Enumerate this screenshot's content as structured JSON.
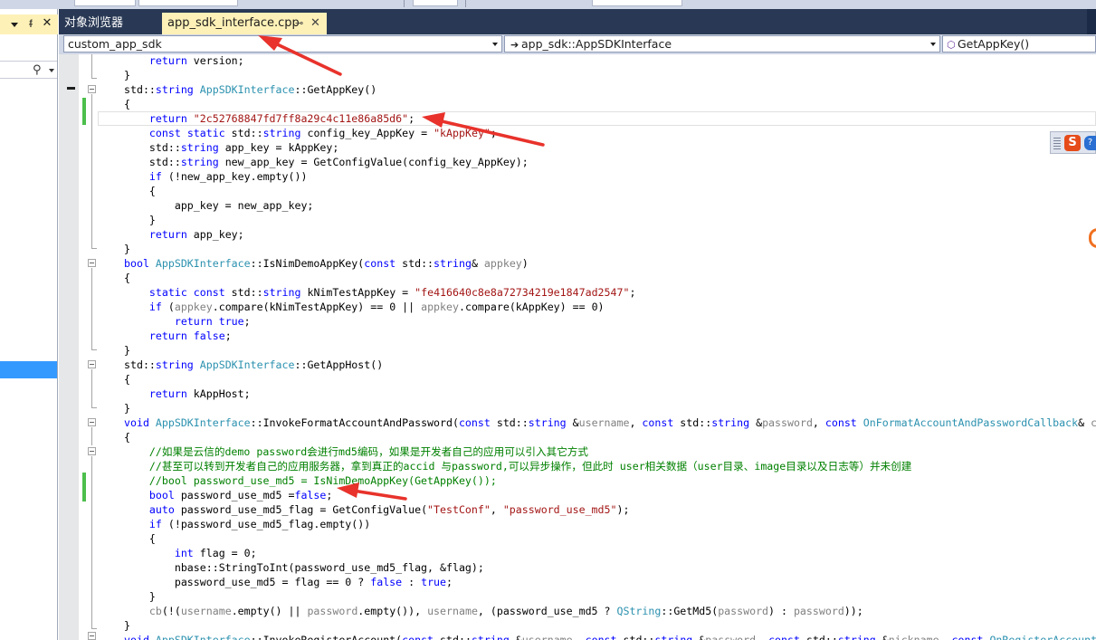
{
  "left_panel": {
    "search_icon": "search-icon"
  },
  "tabs": {
    "object_browser": "对象浏览器",
    "active_file": "app_sdk_interface.cpp",
    "pin_glyph": "⊸",
    "close_glyph": "✕"
  },
  "navigation": {
    "project": "custom_app_sdk",
    "class": "app_sdk::AppSDKInterface",
    "member": "GetAppKey()"
  },
  "code": {
    "lines": [
      [
        [
          "",
          "    "
        ],
        [
          "k",
          "return"
        ],
        [
          "",
          " version;"
        ]
      ],
      [
        [
          "",
          "}"
        ]
      ],
      [
        [
          "",
          "std::"
        ],
        [
          "k",
          "string"
        ],
        [
          "",
          " "
        ],
        [
          "t",
          "AppSDKInterface"
        ],
        [
          "",
          "::GetAppKey()"
        ]
      ],
      [
        [
          "",
          "{"
        ]
      ],
      [
        [
          "",
          "    "
        ],
        [
          "k",
          "return"
        ],
        [
          "",
          " "
        ],
        [
          "s",
          "\"2c52768847fd7ff8a29c4c11e86a85d6\""
        ],
        [
          "",
          ";"
        ]
      ],
      [
        [
          "",
          "    "
        ],
        [
          "k",
          "const"
        ],
        [
          "",
          " "
        ],
        [
          "k",
          "static"
        ],
        [
          "",
          " std::"
        ],
        [
          "k",
          "string"
        ],
        [
          "",
          " config_key_AppKey = "
        ],
        [
          "s",
          "\"kAppKey\""
        ],
        [
          "",
          ";"
        ]
      ],
      [
        [
          "",
          "    std::"
        ],
        [
          "k",
          "string"
        ],
        [
          "",
          " app_key = kAppKey;"
        ]
      ],
      [
        [
          "",
          "    std::"
        ],
        [
          "k",
          "string"
        ],
        [
          "",
          " new_app_key = GetConfigValue(config_key_AppKey);"
        ]
      ],
      [
        [
          "",
          "    "
        ],
        [
          "k",
          "if"
        ],
        [
          "",
          " (!new_app_key.empty())"
        ]
      ],
      [
        [
          "",
          "    {"
        ]
      ],
      [
        [
          "",
          "        app_key = new_app_key;"
        ]
      ],
      [
        [
          "",
          "    }"
        ]
      ],
      [
        [
          "",
          "    "
        ],
        [
          "k",
          "return"
        ],
        [
          "",
          " app_key;"
        ]
      ],
      [
        [
          "",
          "}"
        ]
      ],
      [
        [
          "k",
          "bool"
        ],
        [
          "",
          " "
        ],
        [
          "t",
          "AppSDKInterface"
        ],
        [
          "",
          "::IsNimDemoAppKey("
        ],
        [
          "k",
          "const"
        ],
        [
          "",
          " std::"
        ],
        [
          "k",
          "string"
        ],
        [
          "",
          "& "
        ],
        [
          "g",
          "appkey"
        ],
        [
          "",
          ")"
        ]
      ],
      [
        [
          "",
          "{"
        ]
      ],
      [
        [
          "",
          "    "
        ],
        [
          "k",
          "static"
        ],
        [
          "",
          " "
        ],
        [
          "k",
          "const"
        ],
        [
          "",
          " std::"
        ],
        [
          "k",
          "string"
        ],
        [
          "",
          " kNimTestAppKey = "
        ],
        [
          "s",
          "\"fe416640c8e8a72734219e1847ad2547\""
        ],
        [
          "",
          ";"
        ]
      ],
      [
        [
          "",
          "    "
        ],
        [
          "k",
          "if"
        ],
        [
          "",
          " ("
        ],
        [
          "g",
          "appkey"
        ],
        [
          "",
          ".compare(kNimTestAppKey) == 0 || "
        ],
        [
          "g",
          "appkey"
        ],
        [
          "",
          ".compare(kAppKey) == 0)"
        ]
      ],
      [
        [
          "",
          "        "
        ],
        [
          "k",
          "return"
        ],
        [
          "",
          " "
        ],
        [
          "k",
          "true"
        ],
        [
          "",
          ";"
        ]
      ],
      [
        [
          "",
          "    "
        ],
        [
          "k",
          "return"
        ],
        [
          "",
          " "
        ],
        [
          "k",
          "false"
        ],
        [
          "",
          ";"
        ]
      ],
      [
        [
          "",
          "}"
        ]
      ],
      [
        [
          "",
          "std::"
        ],
        [
          "k",
          "string"
        ],
        [
          "",
          " "
        ],
        [
          "t",
          "AppSDKInterface"
        ],
        [
          "",
          "::GetAppHost()"
        ]
      ],
      [
        [
          "",
          "{"
        ]
      ],
      [
        [
          "",
          "    "
        ],
        [
          "k",
          "return"
        ],
        [
          "",
          " kAppHost;"
        ]
      ],
      [
        [
          "",
          "}"
        ]
      ],
      [
        [
          "k",
          "void"
        ],
        [
          "",
          " "
        ],
        [
          "t",
          "AppSDKInterface"
        ],
        [
          "",
          "::InvokeFormatAccountAndPassword("
        ],
        [
          "k",
          "const"
        ],
        [
          "",
          " std::"
        ],
        [
          "k",
          "string"
        ],
        [
          "",
          " &"
        ],
        [
          "g",
          "username"
        ],
        [
          "",
          ", "
        ],
        [
          "k",
          "const"
        ],
        [
          "",
          " std::"
        ],
        [
          "k",
          "string"
        ],
        [
          "",
          " &"
        ],
        [
          "g",
          "password"
        ],
        [
          "",
          ", "
        ],
        [
          "k",
          "const"
        ],
        [
          "",
          " "
        ],
        [
          "t",
          "OnFormatAccountAndPasswordCallback"
        ],
        [
          "",
          "& "
        ],
        [
          "g",
          "cb"
        ],
        [
          "",
          ")"
        ]
      ],
      [
        [
          "",
          "{"
        ]
      ],
      [
        [
          "c",
          "    //如果是云信的demo password会进行md5编码，如果是开发者自己的应用可以引入其它方式"
        ]
      ],
      [
        [
          "c",
          "    //甚至可以转到开发者自己的应用服务器，拿到真正的accid 与password,可以异步操作，但此时 user相关数据（user目录、image目录以及日志等）并未创建"
        ]
      ],
      [
        [
          "c",
          "    //bool password_use_md5 = IsNimDemoAppKey(GetAppKey());"
        ]
      ],
      [
        [
          "",
          "    "
        ],
        [
          "k",
          "bool"
        ],
        [
          "",
          " password_use_md5 ="
        ],
        [
          "k",
          "false"
        ],
        [
          "",
          ";"
        ]
      ],
      [
        [
          "",
          "    "
        ],
        [
          "k",
          "auto"
        ],
        [
          "",
          " password_use_md5_flag = GetConfigValue("
        ],
        [
          "s",
          "\"TestConf\""
        ],
        [
          "",
          ", "
        ],
        [
          "s",
          "\"password_use_md5\""
        ],
        [
          "",
          ");"
        ]
      ],
      [
        [
          "",
          "    "
        ],
        [
          "k",
          "if"
        ],
        [
          "",
          " (!password_use_md5_flag.empty())"
        ]
      ],
      [
        [
          "",
          "    {"
        ]
      ],
      [
        [
          "",
          "        "
        ],
        [
          "k",
          "int"
        ],
        [
          "",
          " flag = 0;"
        ]
      ],
      [
        [
          "",
          "        nbase::StringToInt(password_use_md5_flag, &flag);"
        ]
      ],
      [
        [
          "",
          "        password_use_md5 = flag == 0 ? "
        ],
        [
          "k",
          "false"
        ],
        [
          "",
          " : "
        ],
        [
          "k",
          "true"
        ],
        [
          "",
          ";"
        ]
      ],
      [
        [
          "",
          "    }"
        ]
      ],
      [
        [
          "",
          "    "
        ],
        [
          "g",
          "cb"
        ],
        [
          "",
          "(!("
        ],
        [
          "g",
          "username"
        ],
        [
          "",
          ".empty() || "
        ],
        [
          "g",
          "password"
        ],
        [
          "",
          ".empty()), "
        ],
        [
          "g",
          "username"
        ],
        [
          "",
          ", (password_use_md5 ? "
        ],
        [
          "t",
          "QString"
        ],
        [
          "",
          "::GetMd5("
        ],
        [
          "g",
          "password"
        ],
        [
          "",
          ") : "
        ],
        [
          "g",
          "password"
        ],
        [
          "",
          "));"
        ]
      ],
      [
        [
          "",
          "}"
        ]
      ],
      [
        [
          "k",
          "void"
        ],
        [
          "",
          " "
        ],
        [
          "t",
          "AppSDKInterface"
        ],
        [
          "",
          "::InvokeRegisterAccount("
        ],
        [
          "k",
          "const"
        ],
        [
          "",
          " std::"
        ],
        [
          "k",
          "string"
        ],
        [
          "",
          " &"
        ],
        [
          "g",
          "username"
        ],
        [
          "",
          ", "
        ],
        [
          "k",
          "const"
        ],
        [
          "",
          " std::"
        ],
        [
          "k",
          "string"
        ],
        [
          "",
          " &"
        ],
        [
          "g",
          "password"
        ],
        [
          "",
          ", "
        ],
        [
          "k",
          "const"
        ],
        [
          "",
          " std::"
        ],
        [
          "k",
          "string"
        ],
        [
          "",
          " &"
        ],
        [
          "g",
          "nickname"
        ],
        [
          "",
          ", "
        ],
        [
          "k",
          "const"
        ],
        [
          "",
          " "
        ],
        [
          "t",
          "OnRegisterAccountCallback"
        ],
        [
          "",
          "& "
        ],
        [
          "g",
          "cb"
        ],
        [
          "",
          ")"
        ]
      ]
    ]
  },
  "colors": {
    "keyword": "#0000ff",
    "type": "#2b91af",
    "string": "#a31515",
    "comment": "#008000",
    "param": "#808080",
    "annotation_arrow": "#e8322b",
    "change_bar": "#4cbf4c",
    "tab_active_bg": "#fef1b7",
    "tabbar_bg": "#293955"
  },
  "icons": {
    "ime_logo": "S",
    "ime_extra": "?"
  }
}
